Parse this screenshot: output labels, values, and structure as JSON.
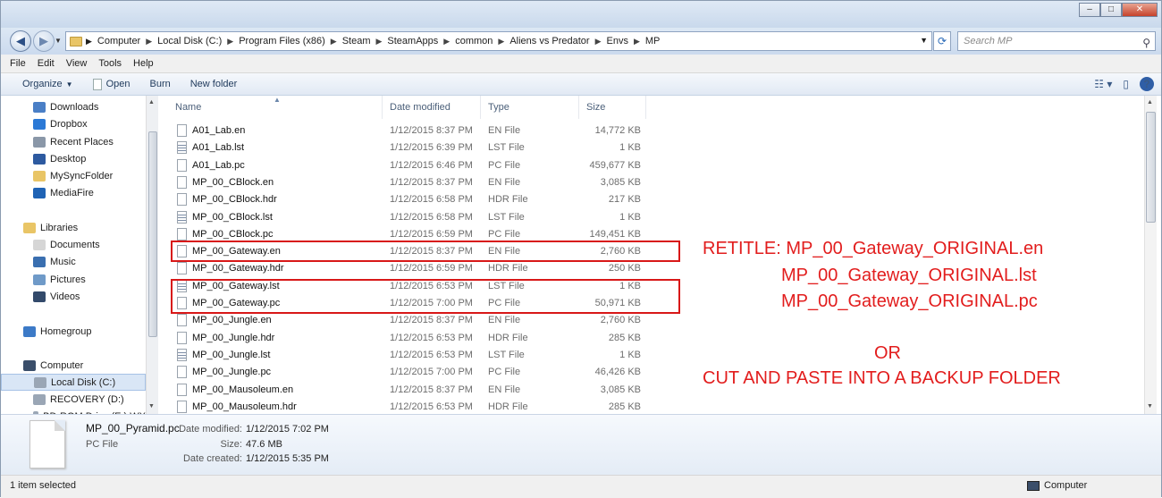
{
  "window": {
    "minimize_icon": "minimize-icon",
    "maximize_icon": "maximize-icon",
    "close_icon": "close-icon"
  },
  "address": {
    "breadcrumbs": [
      "Computer",
      "Local Disk (C:)",
      "Program Files (x86)",
      "Steam",
      "SteamApps",
      "common",
      "Aliens vs Predator",
      "Envs",
      "MP"
    ],
    "search_placeholder": "Search MP"
  },
  "menu": [
    "File",
    "Edit",
    "View",
    "Tools",
    "Help"
  ],
  "toolbar": {
    "organize": "Organize",
    "open": "Open",
    "burn": "Burn",
    "new_folder": "New folder"
  },
  "sidebar": [
    {
      "label": "Downloads",
      "icon": "downloads-icon",
      "color": "#4a7fc6"
    },
    {
      "label": "Dropbox",
      "icon": "dropbox-icon",
      "color": "#2b79d6"
    },
    {
      "label": "Recent Places",
      "icon": "recent-places-icon",
      "color": "#8a97a8"
    },
    {
      "label": "Desktop",
      "icon": "desktop-icon",
      "color": "#2d5aa0"
    },
    {
      "label": "MySyncFolder",
      "icon": "folder-icon",
      "color": "#e9c566"
    },
    {
      "label": "MediaFire",
      "icon": "mediafire-icon",
      "color": "#1f63b5"
    },
    {
      "label": "Libraries",
      "icon": "libraries-icon",
      "color": "#e9c566"
    },
    {
      "label": "Documents",
      "icon": "documents-icon",
      "color": "#d6d6d6"
    },
    {
      "label": "Music",
      "icon": "music-icon",
      "color": "#3a6fb0"
    },
    {
      "label": "Pictures",
      "icon": "pictures-icon",
      "color": "#6f9ac8"
    },
    {
      "label": "Videos",
      "icon": "videos-icon",
      "color": "#334a6b"
    },
    {
      "label": "Homegroup",
      "icon": "homegroup-icon",
      "color": "#3c7ac7"
    },
    {
      "label": "Computer",
      "icon": "computer-icon",
      "color": "#3a4e6a"
    },
    {
      "label": "Local Disk (C:)",
      "icon": "disk-icon",
      "color": "#9aa6b5"
    },
    {
      "label": "RECOVERY (D:)",
      "icon": "disk-icon",
      "color": "#9aa6b5"
    },
    {
      "label": "BD-ROM Drive (E:) WX",
      "icon": "disc-drive-icon",
      "color": "#9aa6b5"
    }
  ],
  "columns": {
    "name": "Name",
    "date": "Date modified",
    "type": "Type",
    "size": "Size"
  },
  "files": [
    {
      "name": "A01_Lab.en",
      "date": "1/12/2015 8:37 PM",
      "type": "EN File",
      "size": "14,772 KB"
    },
    {
      "name": "A01_Lab.lst",
      "date": "1/12/2015 6:39 PM",
      "type": "LST File",
      "size": "1 KB"
    },
    {
      "name": "A01_Lab.pc",
      "date": "1/12/2015 6:46 PM",
      "type": "PC File",
      "size": "459,677 KB"
    },
    {
      "name": "MP_00_CBlock.en",
      "date": "1/12/2015 8:37 PM",
      "type": "EN File",
      "size": "3,085 KB"
    },
    {
      "name": "MP_00_CBlock.hdr",
      "date": "1/12/2015 6:58 PM",
      "type": "HDR File",
      "size": "217 KB"
    },
    {
      "name": "MP_00_CBlock.lst",
      "date": "1/12/2015 6:58 PM",
      "type": "LST File",
      "size": "1 KB"
    },
    {
      "name": "MP_00_CBlock.pc",
      "date": "1/12/2015 6:59 PM",
      "type": "PC File",
      "size": "149,451 KB"
    },
    {
      "name": "MP_00_Gateway.en",
      "date": "1/12/2015 8:37 PM",
      "type": "EN File",
      "size": "2,760 KB"
    },
    {
      "name": "MP_00_Gateway.hdr",
      "date": "1/12/2015 6:59 PM",
      "type": "HDR File",
      "size": "250 KB"
    },
    {
      "name": "MP_00_Gateway.lst",
      "date": "1/12/2015 6:53 PM",
      "type": "LST File",
      "size": "1 KB"
    },
    {
      "name": "MP_00_Gateway.pc",
      "date": "1/12/2015 7:00 PM",
      "type": "PC File",
      "size": "50,971 KB"
    },
    {
      "name": "MP_00_Jungle.en",
      "date": "1/12/2015 8:37 PM",
      "type": "EN File",
      "size": "2,760 KB"
    },
    {
      "name": "MP_00_Jungle.hdr",
      "date": "1/12/2015 6:53 PM",
      "type": "HDR File",
      "size": "285 KB"
    },
    {
      "name": "MP_00_Jungle.lst",
      "date": "1/12/2015 6:53 PM",
      "type": "LST File",
      "size": "1 KB"
    },
    {
      "name": "MP_00_Jungle.pc",
      "date": "1/12/2015 7:00 PM",
      "type": "PC File",
      "size": "46,426 KB"
    },
    {
      "name": "MP_00_Mausoleum.en",
      "date": "1/12/2015 8:37 PM",
      "type": "EN File",
      "size": "3,085 KB"
    },
    {
      "name": "MP_00_Mausoleum.hdr",
      "date": "1/12/2015 6:53 PM",
      "type": "HDR File",
      "size": "285 KB"
    }
  ],
  "annotation": {
    "line1": "RETITLE: MP_00_Gateway_ORIGINAL.en",
    "line2": "MP_00_Gateway_ORIGINAL.lst",
    "line3": "MP_00_Gateway_ORIGINAL.pc",
    "or": "OR",
    "line4": "CUT AND PASTE INTO A BACKUP FOLDER",
    "color": "#e21d1d"
  },
  "details": {
    "filename": "MP_00_Pyramid.pc",
    "type": "PC File",
    "modified_label": "Date modified:",
    "modified_value": "1/12/2015 7:02 PM",
    "size_label": "Size:",
    "size_value": "47.6 MB",
    "created_label": "Date created:",
    "created_value": "1/12/2015 5:35 PM"
  },
  "status": {
    "left": "1 item selected",
    "right": "Computer"
  }
}
